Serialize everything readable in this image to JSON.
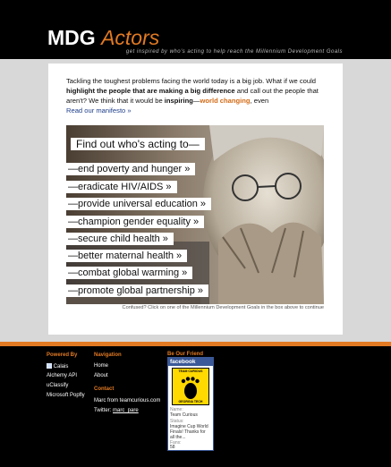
{
  "header": {
    "logo_part1": "MDG",
    "logo_part2": "Actors",
    "tagline": "get inspired by who's acting to help reach the Millennium Development Goals"
  },
  "intro": {
    "text1": "Tackling the toughest problems facing the world today is a big job. What if we could ",
    "bold1": "highlight the people that are making a big difference",
    "text2": " and call out the people that aren't? We think that it would be ",
    "bold2": "inspiring",
    "dash": "—",
    "orange": "world changing",
    "text3": ", even",
    "link": "Read our manifesto »"
  },
  "hero": {
    "heading": "Find out who's acting to—",
    "goals": [
      "—end poverty and hunger",
      "—eradicate HIV/AIDS",
      "—provide universal education",
      "—champion gender equality",
      "—secure child health",
      "—better maternal health",
      "—combat global warming",
      "—promote global partnership"
    ],
    "arrow": "»",
    "caption": "Confused? Click on one of the Millennium Development Goals in the box above to continue"
  },
  "footer": {
    "powered_heading": "Powered By",
    "powered": [
      "Calais",
      "Alchemy API",
      "uClassify",
      "Microsoft Popfly"
    ],
    "nav_heading": "Navigation",
    "nav": [
      "Home",
      "About"
    ],
    "contact_heading": "Contact",
    "contact": [
      "Marc from teamcurious.com",
      "Twitter: "
    ],
    "twitter_handle": "marc_pare",
    "friend_heading": "Be Our Friend",
    "facebook": {
      "title": "facebook",
      "badge_top": "TEAM CURIOUS",
      "badge_bottom": "GEORGIA TECH",
      "name_label": "Name:",
      "name": "Team Curious",
      "status_label": "Status:",
      "status": [
        "Imagine Cup World",
        "Finals! Thanks for",
        "all the..."
      ],
      "fans_label": "Fans:",
      "fans": "58"
    }
  },
  "colors": {
    "accent": "#e27a23",
    "facebook": "#3b5998",
    "badge": "#ffd900"
  }
}
